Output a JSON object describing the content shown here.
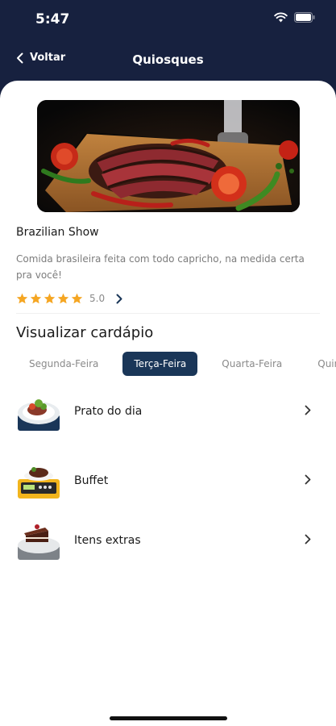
{
  "status_bar": {
    "time": "5:47",
    "icons": [
      "wifi-icon",
      "battery-icon"
    ]
  },
  "nav": {
    "back_label": "Voltar",
    "title": "Quiosques"
  },
  "restaurant": {
    "name": "Brazilian Show",
    "description": "Comida brasileira feita com todo capricho, na medida certa pra você!",
    "rating_value": "5.0",
    "stars": 5
  },
  "menu_section": {
    "title": "Visualizar cardápio",
    "tabs": [
      {
        "label": "Segunda-Feira",
        "active": false
      },
      {
        "label": "Terça-Feira",
        "active": true
      },
      {
        "label": "Quarta-Feira",
        "active": false
      },
      {
        "label": "Quinta-Feira",
        "active": false
      }
    ],
    "items": [
      {
        "label": "Prato do dia",
        "icon": "plate-of-food-icon"
      },
      {
        "label": "Buffet",
        "icon": "weighing-scale-food-icon"
      },
      {
        "label": "Itens extras",
        "icon": "cake-slice-icon"
      }
    ]
  },
  "colors": {
    "header_bg": "#17213f",
    "active_tab_bg": "#1a3658",
    "star": "#f5a623",
    "text_primary": "#1b1b1b",
    "text_secondary": "#7c7c7c"
  }
}
